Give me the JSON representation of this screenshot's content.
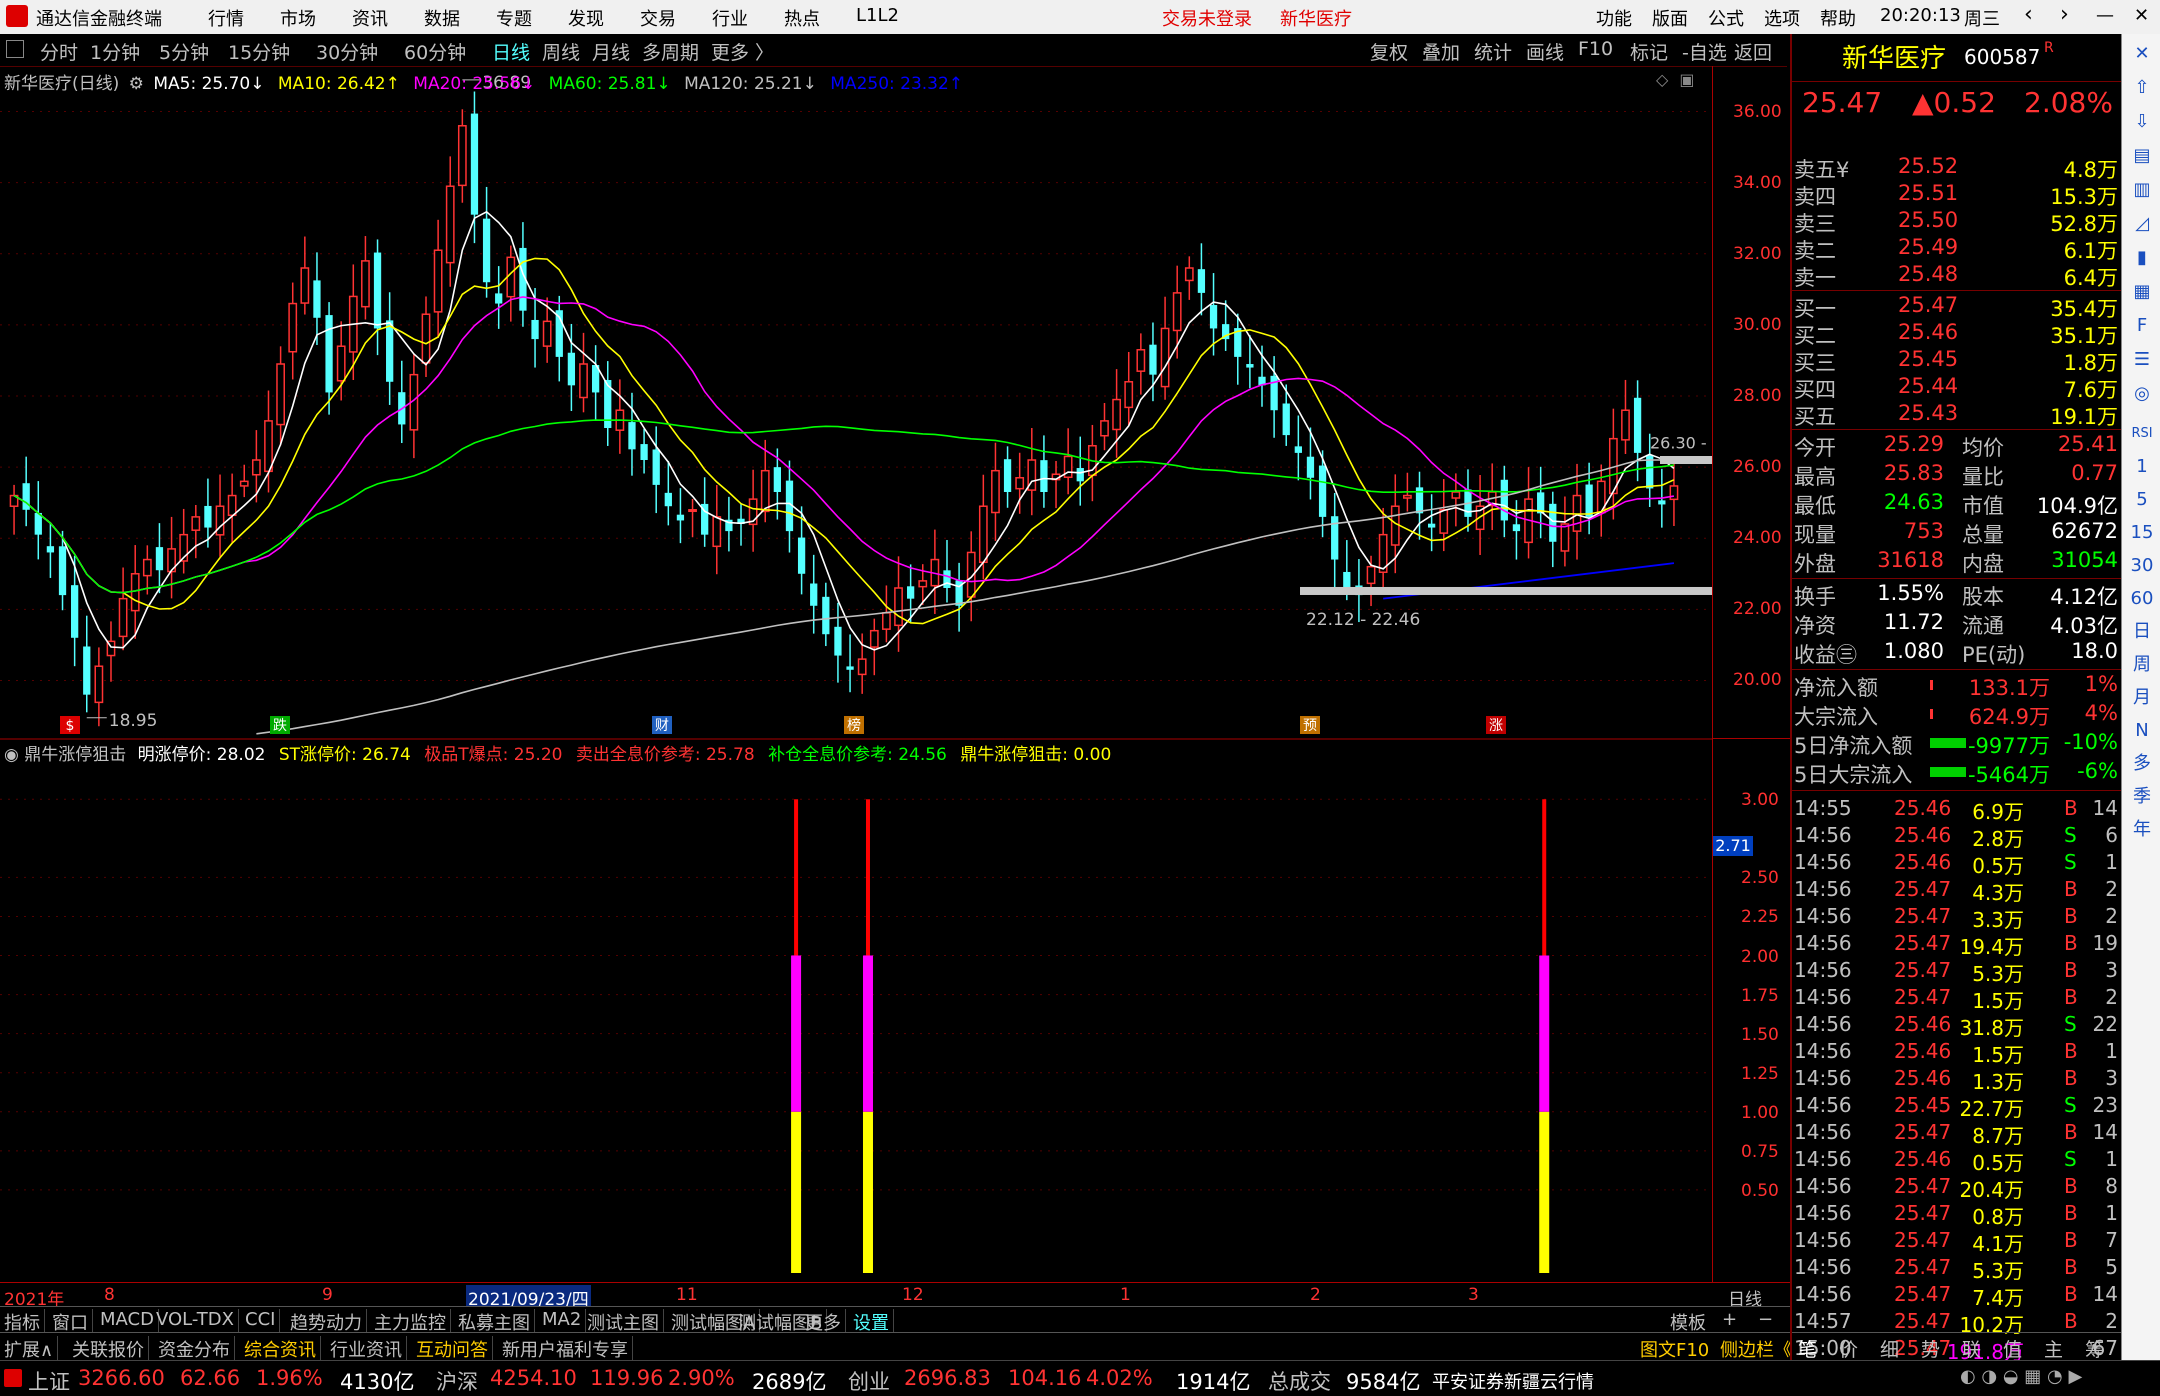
{
  "titlebar": {
    "app_title": "通达信金融终端",
    "menu": [
      "行情",
      "市场",
      "资讯",
      "数据",
      "专题",
      "发现",
      "交易",
      "行业",
      "热点",
      "L1L2"
    ],
    "trade_status": "交易未登录",
    "stock_name": "新华医疗",
    "right_menu": [
      "功能",
      "版面",
      "公式",
      "选项",
      "帮助"
    ],
    "time": "20:20:13",
    "weekday": "周三"
  },
  "periods": [
    "分时",
    "1分钟",
    "5分钟",
    "15分钟",
    "30分钟",
    "60分钟",
    "日线",
    "周线",
    "月线",
    "多周期",
    "更多 〉"
  ],
  "active_period": "日线",
  "tools": [
    "复权",
    "叠加",
    "统计",
    "画线",
    "F10",
    "标记",
    "-自选",
    "返回"
  ],
  "main_header": {
    "name": "新华医疗(日线)",
    "ma5": "MA5: 25.70↓",
    "ma10": "MA10: 26.42↑",
    "ma20": "MA20: 25.56↓",
    "ma60": "MA60: 25.81↓",
    "ma120": "MA120: 25.21↓",
    "ma250": "MA250: 23.32↑"
  },
  "colors": {
    "up": "#ff3333",
    "down": "#54ffff",
    "ma5": "#ffffff",
    "ma10": "#ffff00",
    "ma20": "#ff00ff",
    "ma60": "#00ff00",
    "ma120": "#c0c0c0",
    "ma250": "#0000ff"
  },
  "price_axis": [
    "36.00",
    "34.00",
    "32.00",
    "30.00",
    "28.00",
    "26.00",
    "24.00",
    "22.00",
    "20.00"
  ],
  "annotations": {
    "high": "36.89",
    "low": "18.95",
    "range": "22.12 - 22.46",
    "level": "26.30 -"
  },
  "markers": [
    "跌",
    "财",
    "榜",
    "预",
    "涨"
  ],
  "indicator_header": {
    "name": "鼎牛涨停狙击",
    "l1": "明涨停价: 28.02",
    "l2": "ST涨停价: 26.74",
    "l3": "极品T爆点: 25.20",
    "l4": "卖出全息价参考: 25.78",
    "l5": "补仓全息价参考: 24.56",
    "l6": "鼎牛涨停狙击: 0.00"
  },
  "indicator_axis": [
    "3.00",
    "2.50",
    "2.25",
    "2.00",
    "1.75",
    "1.50",
    "1.25",
    "1.00",
    "0.75",
    "0.50"
  ],
  "indicator_current": "2.71",
  "date_axis": [
    "2021年",
    "8",
    "9",
    "2021/09/23/四",
    "11",
    "12",
    "1",
    "2",
    "3"
  ],
  "date_right": "日线",
  "indicator_tabs": [
    "指标",
    "窗口",
    "MACD",
    "VOL-TDX",
    "CCI",
    "趋势动力",
    "主力监控",
    "私募主图",
    "MA2",
    "测试主图",
    "测试幅图A",
    "测试幅图B",
    "更多",
    "设置"
  ],
  "template_label": "模板",
  "ext_tabs": [
    "扩展∧",
    "关联报价",
    "资金分布",
    "综合资讯",
    "行业资讯",
    "互动问答",
    "新用户福利专享"
  ],
  "quote": {
    "name": "新华医疗",
    "code": "600587",
    "flag": "R",
    "price": "25.47",
    "change": "▲0.52",
    "pct": "2.08%",
    "asks": [
      [
        "卖五¥",
        "25.52",
        "4.8万"
      ],
      [
        "卖四",
        "25.51",
        "15.3万"
      ],
      [
        "卖三",
        "25.50",
        "52.8万"
      ],
      [
        "卖二",
        "25.49",
        "6.1万"
      ],
      [
        "卖一",
        "25.48",
        "6.4万"
      ]
    ],
    "bids": [
      [
        "买一",
        "25.47",
        "35.4万"
      ],
      [
        "买二",
        "25.46",
        "35.1万"
      ],
      [
        "买三",
        "25.45",
        "1.8万"
      ],
      [
        "买四",
        "25.44",
        "7.6万"
      ],
      [
        "买五",
        "25.43",
        "19.1万"
      ]
    ],
    "stats": [
      [
        "今开",
        "25.29",
        "均价",
        "25.41"
      ],
      [
        "最高",
        "25.83",
        "量比",
        "0.77"
      ],
      [
        "最低",
        "24.63",
        "市值",
        "104.9亿"
      ],
      [
        "现量",
        "753",
        "总量",
        "62672"
      ],
      [
        "外盘",
        "31618",
        "内盘",
        "31054"
      ]
    ],
    "stats2": [
      [
        "换手",
        "1.55%",
        "股本",
        "4.12亿"
      ],
      [
        "净资",
        "11.72",
        "流通",
        "4.03亿"
      ],
      [
        "收益㊂",
        "1.080",
        "PE(动)",
        "18.0"
      ]
    ],
    "flows": [
      [
        "净流入额",
        "133.1万",
        "1%"
      ],
      [
        "大宗流入",
        "624.9万",
        "4%"
      ],
      [
        "5日净流入额",
        "-9977万",
        "-10%"
      ],
      [
        "5日大宗流入",
        "-5464万",
        "-6%"
      ]
    ],
    "ticks": [
      [
        "14:55",
        "25.46",
        "6.9万",
        "B",
        "14"
      ],
      [
        "14:56",
        "25.46",
        "2.8万",
        "S",
        "6"
      ],
      [
        "14:56",
        "25.46",
        "0.5万",
        "S",
        "1"
      ],
      [
        "14:56",
        "25.47",
        "4.3万",
        "B",
        "2"
      ],
      [
        "14:56",
        "25.47",
        "3.3万",
        "B",
        "2"
      ],
      [
        "14:56",
        "25.47",
        "19.4万",
        "B",
        "19"
      ],
      [
        "14:56",
        "25.47",
        "5.3万",
        "B",
        "3"
      ],
      [
        "14:56",
        "25.47",
        "1.5万",
        "B",
        "2"
      ],
      [
        "14:56",
        "25.46",
        "31.8万",
        "S",
        "22"
      ],
      [
        "14:56",
        "25.46",
        "1.5万",
        "B",
        "1"
      ],
      [
        "14:56",
        "25.46",
        "1.3万",
        "B",
        "3"
      ],
      [
        "14:56",
        "25.45",
        "22.7万",
        "S",
        "23"
      ],
      [
        "14:56",
        "25.47",
        "8.7万",
        "B",
        "14"
      ],
      [
        "14:56",
        "25.46",
        "0.5万",
        "S",
        "1"
      ],
      [
        "14:56",
        "25.47",
        "20.4万",
        "B",
        "8"
      ],
      [
        "14:56",
        "25.47",
        "0.8万",
        "B",
        "1"
      ],
      [
        "14:56",
        "25.47",
        "4.1万",
        "B",
        "7"
      ],
      [
        "14:56",
        "25.47",
        "5.3万",
        "B",
        "5"
      ],
      [
        "14:56",
        "25.47",
        "7.4万",
        "B",
        "14"
      ],
      [
        "14:57",
        "25.47",
        "10.2万",
        "B",
        "2"
      ],
      [
        "15:00",
        "25.47",
        "191.8万",
        "",
        "67"
      ]
    ],
    "bottom_tabs": [
      "笔",
      "价",
      "细",
      "势",
      "联",
      "值",
      "主",
      "筹"
    ]
  },
  "right_icons": [
    "close-icon",
    "up-icon",
    "down-icon",
    "grid-icon",
    "list-icon",
    "chart-icon",
    "candle-icon",
    "f10-icon",
    "fin-icon",
    "news-icon",
    "cycle-icon"
  ],
  "right_labels": [
    "RSI",
    "1",
    "5",
    "15",
    "30",
    "60",
    "日",
    "周",
    "月",
    "N",
    "多",
    "季",
    "年"
  ],
  "status": {
    "sh_label": "上证",
    "sh_val": "3266.60",
    "sh_chg": "62.66",
    "sh_pct": "1.96%",
    "sh_amt": "4130亿",
    "hs_label": "沪深",
    "hs_val": "4254.10",
    "hs_chg": "119.96",
    "hs_pct": "2.90%",
    "hs_amt": "2689亿",
    "cy_label": "创业",
    "cy_val": "2696.83",
    "cy_chg": "104.16",
    "cy_pct": "4.02%",
    "cy_amt": "1914亿",
    "total_label": "总成交",
    "total_val": "9584亿",
    "broker": "平安证券新疆云行情",
    "f10": "图文F10",
    "side": "侧边栏《"
  },
  "chart_data": {
    "type": "candlestick",
    "price_range": [
      19,
      37
    ],
    "high": 36.89,
    "low": 18.95,
    "closes": [
      25.2,
      24.8,
      24.1,
      23.6,
      22.4,
      21.2,
      19.6,
      20.4,
      21.1,
      22.3,
      23.0,
      23.4,
      23.1,
      23.7,
      24.1,
      24.6,
      24.3,
      24.9,
      25.2,
      25.6,
      26.2,
      27.3,
      28.9,
      30.6,
      31.6,
      30.2,
      28.1,
      29.4,
      30.8,
      31.8,
      29.9,
      28.4,
      27.2,
      28.6,
      30.3,
      32.1,
      33.9,
      35.6,
      33.1,
      31.2,
      30.6,
      31.9,
      30.4,
      29.6,
      30.1,
      29.1,
      28.3,
      28.9,
      28.1,
      27.1,
      27.6,
      26.5,
      26.2,
      25.5,
      24.9,
      24.5,
      24.8,
      24.1,
      24.6,
      24.2,
      24.4,
      25.1,
      25.9,
      25.3,
      24.2,
      23.0,
      22.1,
      21.3,
      20.7,
      20.3,
      20.6,
      21.4,
      21.9,
      22.6,
      22.3,
      22.8,
      23.4,
      22.6,
      22.1,
      23.6,
      24.9,
      25.9,
      25.3,
      25.7,
      26.2,
      25.3,
      25.8,
      26.3,
      25.6,
      26.6,
      27.3,
      27.9,
      28.4,
      29.3,
      28.6,
      29.9,
      30.9,
      31.6,
      30.9,
      29.9,
      29.6,
      29.1,
      28.8,
      28.3,
      27.6,
      26.9,
      26.4,
      25.7,
      24.6,
      23.4,
      22.6,
      22.4,
      23.2,
      24.1,
      24.9,
      25.2,
      24.7,
      24.3,
      24.8,
      25.3,
      24.6,
      24.9,
      25.3,
      24.5,
      24.2,
      25.1,
      24.7,
      23.9,
      24.4,
      25.2,
      24.6,
      25.6,
      26.8,
      27.6,
      26.4,
      25.4,
      24.95,
      25.47
    ],
    "indicator_bars": [
      {
        "pos": 0.465,
        "values": [
          1,
          2,
          3
        ]
      },
      {
        "pos": 0.507,
        "values": [
          1,
          2,
          3
        ]
      },
      {
        "pos": 0.902,
        "values": [
          1,
          2,
          3
        ]
      }
    ],
    "indicator_range": [
      0,
      3.2
    ]
  }
}
